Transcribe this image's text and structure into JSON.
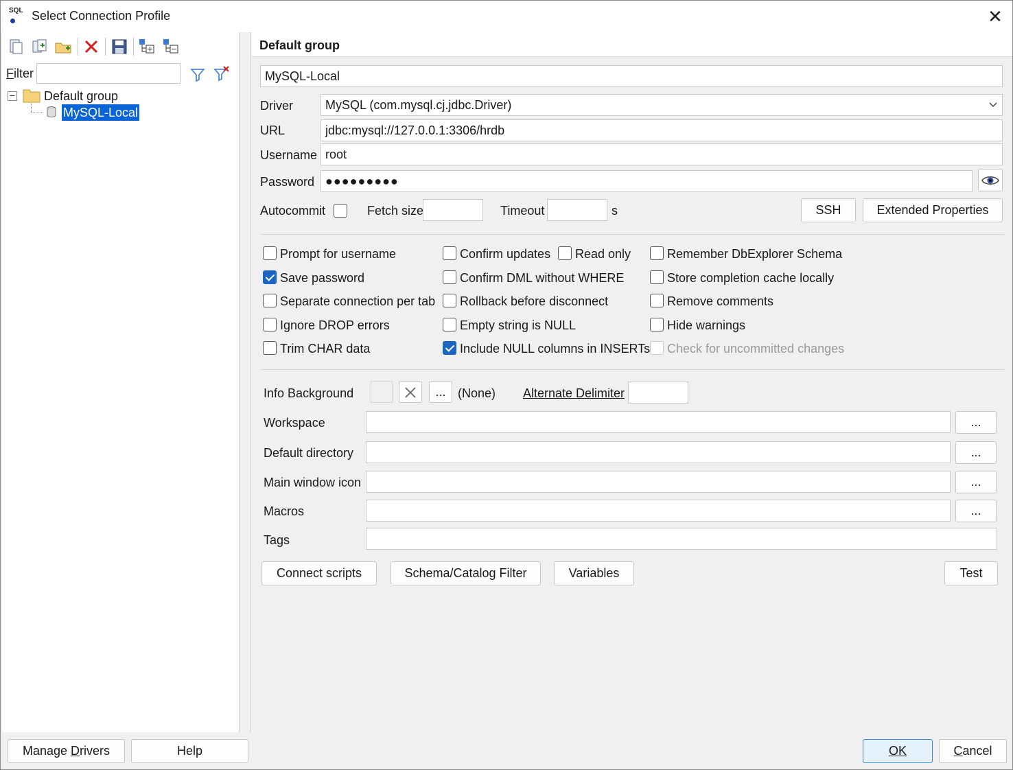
{
  "window": {
    "title": "Select Connection Profile"
  },
  "toolbar": {
    "icons": [
      "new-profile-icon",
      "copy-profile-icon",
      "new-group-icon",
      "delete-icon",
      "save-icon",
      "expand-all-icon",
      "collapse-all-icon"
    ]
  },
  "filter": {
    "label": "Filter",
    "value": ""
  },
  "tree": {
    "group": "Default group",
    "profile": "MySQL-Local"
  },
  "header": {
    "title": "Default group"
  },
  "profile": {
    "name": "MySQL-Local",
    "driver_label": "Driver",
    "driver": "MySQL (com.mysql.cj.jdbc.Driver)",
    "url_label": "URL",
    "url": "jdbc:mysql://127.0.0.1:3306/hrdb",
    "username_label": "Username",
    "username": "root",
    "password_label": "Password",
    "password": "●●●●●●●●●",
    "autocommit_label": "Autocommit",
    "fetch_size_label": "Fetch size",
    "fetch_size": "",
    "timeout_label": "Timeout",
    "timeout": "",
    "timeout_unit": "s",
    "ssh_button": "SSH",
    "extended_button": "Extended Properties"
  },
  "options": {
    "col1": [
      {
        "label": "Prompt for username",
        "checked": false
      },
      {
        "label": "Save password",
        "checked": true
      },
      {
        "label": "Separate connection per tab",
        "checked": false
      },
      {
        "label": "Ignore DROP errors",
        "checked": false
      },
      {
        "label": "Trim CHAR data",
        "checked": false
      }
    ],
    "col2": [
      {
        "label": "Confirm updates",
        "checked": false
      },
      {
        "label": "Confirm DML without WHERE",
        "checked": false
      },
      {
        "label": "Rollback before disconnect",
        "checked": false
      },
      {
        "label": "Empty string is NULL",
        "checked": false
      },
      {
        "label": "Include NULL columns in INSERTs",
        "checked": true
      }
    ],
    "read_only": {
      "label": "Read only",
      "checked": false
    },
    "col3": [
      {
        "label": "Remember DbExplorer Schema",
        "checked": false
      },
      {
        "label": "Store completion cache locally",
        "checked": false
      },
      {
        "label": "Remove comments",
        "checked": false
      },
      {
        "label": "Hide warnings",
        "checked": false
      },
      {
        "label": "Check for uncommitted changes",
        "checked": false,
        "disabled": true
      }
    ]
  },
  "extra": {
    "info_bg_label": "Info Background",
    "info_bg_value": "(None)",
    "browse": "...",
    "alt_delim_label": "Alternate Delimiter",
    "alt_delim": "",
    "workspace_label": "Workspace",
    "default_dir_label": "Default directory",
    "main_icon_label": "Main window icon",
    "macros_label": "Macros",
    "tags_label": "Tags"
  },
  "buttons": {
    "connect_scripts": "Connect scripts",
    "schema_filter": "Schema/Catalog Filter",
    "variables": "Variables",
    "test": "Test",
    "manage_drivers_pre": "Manage ",
    "manage_drivers_u": "D",
    "manage_drivers_post": "rivers",
    "help": "Help",
    "ok": "OK",
    "cancel_u": "C",
    "cancel_post": "ancel"
  }
}
